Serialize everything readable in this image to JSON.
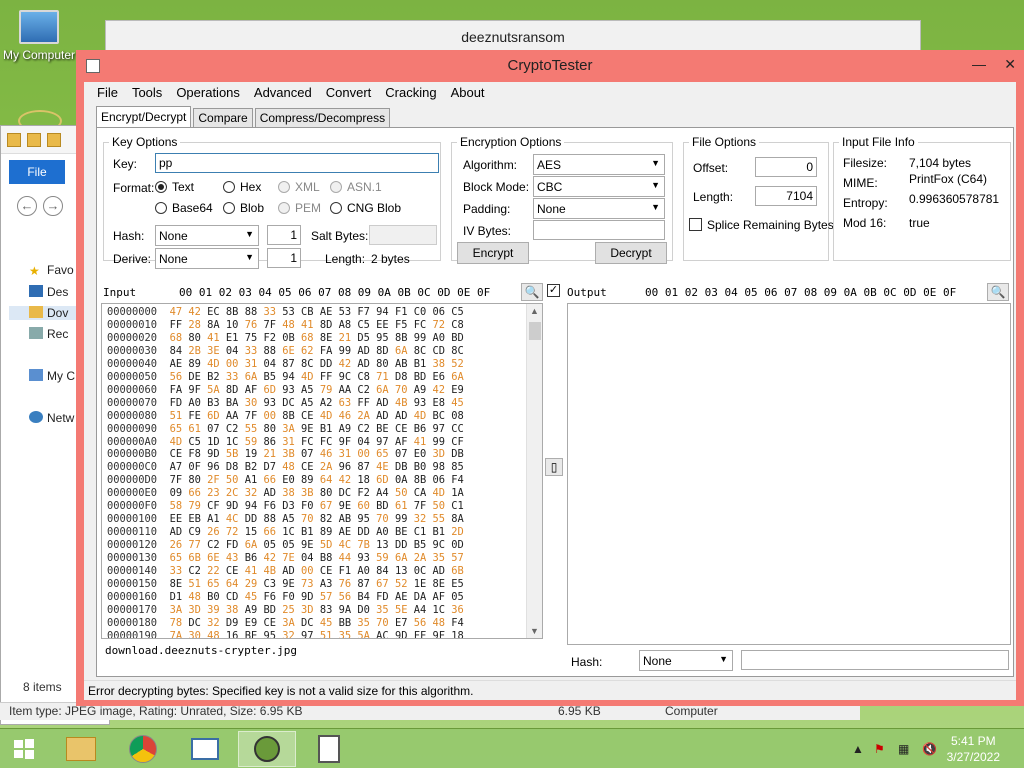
{
  "desktop": {
    "icon_label": "My Computer",
    "bg_window_title": "deeznutsransom"
  },
  "explorer": {
    "file_tab": "File",
    "nav": [
      "Favo",
      "Des",
      "Dov",
      "Rec",
      "My C",
      "Netw"
    ],
    "item_count": "8 items",
    "status_text": "Item type: JPEG image, Rating: Unrated, Size: 6.95 KB",
    "status_size": "6.95 KB",
    "status_location": "Computer"
  },
  "window": {
    "title": "CryptoTester",
    "minimize": "—",
    "close": "✕"
  },
  "menu": [
    "File",
    "Tools",
    "Operations",
    "Advanced",
    "Convert",
    "Cracking",
    "About"
  ],
  "tabs": [
    "Encrypt/Decrypt",
    "Compare",
    "Compress/Decompress"
  ],
  "key_options": {
    "title": "Key Options",
    "key_label": "Key:",
    "key_value": "pp",
    "format_label": "Format:",
    "formats": {
      "text": "Text",
      "hex": "Hex",
      "xml": "XML",
      "asn1": "ASN.1",
      "base64": "Base64",
      "blob": "Blob",
      "pem": "PEM",
      "cng": "CNG Blob"
    },
    "hash_label": "Hash:",
    "hash_value": "None",
    "hash_count": "1",
    "salt_label": "Salt Bytes:",
    "derive_label": "Derive:",
    "derive_value": "None",
    "derive_count": "1",
    "length_label": "Length:",
    "length_value": "2 bytes"
  },
  "encryption_options": {
    "title": "Encryption Options",
    "algorithm_label": "Algorithm:",
    "algorithm": "AES",
    "block_mode_label": "Block Mode:",
    "block_mode": "CBC",
    "padding_label": "Padding:",
    "padding": "None",
    "iv_label": "IV Bytes:",
    "encrypt": "Encrypt",
    "decrypt": "Decrypt"
  },
  "file_options": {
    "title": "File Options",
    "offset_label": "Offset:",
    "offset": "0",
    "length_label": "Length:",
    "length": "7104",
    "splice_label": "Splice Remaining Bytes"
  },
  "input_info": {
    "title": "Input File Info",
    "filesize_label": "Filesize:",
    "filesize": "7,104 bytes",
    "mime_label": "MIME:",
    "mime": "PrintFox (C64)",
    "entropy_label": "Entropy:",
    "entropy": "0.996360578781",
    "mod16_label": "Mod 16:",
    "mod16": "true"
  },
  "input_panel": {
    "label": "Input",
    "columns": "00 01 02 03 04 05 06 07 08 09 0A 0B 0C 0D 0E 0F",
    "filename": "download.deeznuts-crypter.jpg",
    "rows": [
      [
        "00000000",
        "47 42 EC 8B 88 33 53 CB AE 53 F7 94 F1 C0 06 C5"
      ],
      [
        "00000010",
        "FF 28 8A 10 76 7F 48 41 8D A8 C5 EE F5 FC 72 C8"
      ],
      [
        "00000020",
        "68 80 41 E1 75 F2 0B 68 8E 21 D5 95 8B 99 A0 BD"
      ],
      [
        "00000030",
        "84 2B 3E 04 33 88 6E 62 FA 99 AD 8D 6A 8C CD 8C"
      ],
      [
        "00000040",
        "AE 89 4D 00 31 04 87 8C DD 42 AD 80 AB B1 38 52"
      ],
      [
        "00000050",
        "56 DE B2 33 6A B5 94 4D FF 9C C8 71 D8 BD E6 6A"
      ],
      [
        "00000060",
        "FA 9F 5A 8D AF 6D 93 A5 79 AA C2 6A 70 A9 42 E9"
      ],
      [
        "00000070",
        "FD A0 B3 BA 30 93 DC A5 A2 63 FF AD 4B 93 E8 45"
      ],
      [
        "00000080",
        "51 FE 6D AA 7F 00 8B CE 4D 46 2A AD AD 4D BC 08"
      ],
      [
        "00000090",
        "65 61 07 C2 55 80 3A 9E B1 A9 C2 BE CE B6 97 CC"
      ],
      [
        "000000A0",
        "4D C5 1D 1C 59 86 31 FC FC 9F 04 97 AF 41 99 CF"
      ],
      [
        "000000B0",
        "CE F8 9D 5B 19 21 3B 07 46 31 00 65 07 E0 3D DB"
      ],
      [
        "000000C0",
        "A7 0F 96 D8 B2 D7 48 CE 2A 96 87 4E DB B0 98 85"
      ],
      [
        "000000D0",
        "7F 80 2F 50 A1 66 E0 89 64 42 18 6D 0A 8B 06 F4"
      ],
      [
        "000000E0",
        "09 66 23 2C 32 AD 38 3B 80 DC F2 A4 50 CA 4D 1A"
      ],
      [
        "000000F0",
        "58 79 CF 9D 94 F6 D3 F0 67 9E 60 BD 61 7F 50 C1"
      ],
      [
        "00000100",
        "EE EB A1 4C DD 88 A5 70 82 AB 95 70 99 32 55 8A"
      ],
      [
        "00000110",
        "AD C9 26 72 15 66 1C B1 89 AE DD A0 BE C1 B1 2D"
      ],
      [
        "00000120",
        "26 77 C2 FD 6A 05 05 9E 5D 4C 7B 13 DD B5 9C 0D"
      ],
      [
        "00000130",
        "65 6B 6E 43 B6 42 7E 04 B8 44 93 59 6A 2A 35 57"
      ],
      [
        "00000140",
        "33 C2 22 CE 41 4B AD 00 CE F1 A0 84 13 0C AD 6B"
      ],
      [
        "00000150",
        "8E 51 65 64 29 C3 9E 73 A3 76 87 67 52 1E 8E E5"
      ],
      [
        "00000160",
        "D1 48 B0 CD 45 F6 F0 9D 57 56 B4 FD AE DA AF 05"
      ],
      [
        "00000170",
        "3A 3D 39 38 A9 BD 25 3D 83 9A D0 35 5E A4 1C 36"
      ],
      [
        "00000180",
        "78 DC 32 D9 E9 CE 3A DC 45 BB 35 70 E7 56 48 F4"
      ],
      [
        "00000190",
        "7A 30 48 16 BE 95 32 97 51 35 5A AC 9D FF 9F 18"
      ]
    ]
  },
  "output_panel": {
    "label": "Output",
    "columns": "00 01 02 03 04 05 06 07 08 09 0A 0B 0C 0D 0E 0F",
    "hash_label": "Hash:",
    "hash_value": "None"
  },
  "status": "Error decrypting bytes: Specified key is not a valid size for this algorithm.",
  "taskbar": {
    "time": "5:41 PM",
    "date": "3/27/2022"
  },
  "colors": {
    "title_bar": "#f47a73",
    "highlight_byte": "#e08a2a"
  }
}
